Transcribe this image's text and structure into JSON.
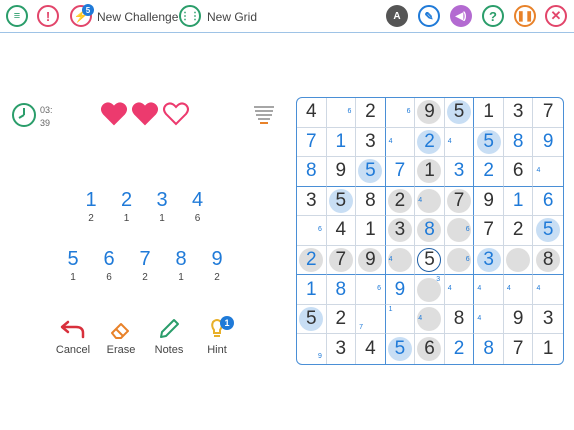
{
  "toolbar": {
    "new_challenge_label": "New Challenge",
    "new_grid_label": "New Grid",
    "challenge_badge": "5",
    "accent": "#1f7ad8",
    "icons": [
      "menu-icon",
      "alert-icon",
      "challenge-icon",
      "grid-icon",
      "contrast-icon",
      "palette-icon",
      "sound-icon",
      "help-icon",
      "pause-icon",
      "close-icon"
    ]
  },
  "timer": {
    "minutes": "03:",
    "seconds": "39"
  },
  "lives": {
    "total": 3,
    "remaining": 2
  },
  "numpad": [
    {
      "digit": "1",
      "count": "2"
    },
    {
      "digit": "2",
      "count": "1"
    },
    {
      "digit": "3",
      "count": "1"
    },
    {
      "digit": "4",
      "count": "6"
    },
    {
      "digit": "5",
      "count": "1"
    },
    {
      "digit": "6",
      "count": "6"
    },
    {
      "digit": "7",
      "count": "2"
    },
    {
      "digit": "8",
      "count": "1"
    },
    {
      "digit": "9",
      "count": "2"
    }
  ],
  "actions": {
    "cancel": "Cancel",
    "erase": "Erase",
    "notes": "Notes",
    "hint": "Hint",
    "hint_badge": "1"
  },
  "board": [
    [
      {
        "v": "4",
        "t": "g"
      },
      {
        "n": "6"
      },
      {
        "v": "2",
        "t": "g"
      },
      {
        "n": "6"
      },
      {
        "v": "9",
        "t": "g",
        "h": "gray"
      },
      {
        "v": "5",
        "t": "g",
        "h": "blue"
      },
      {
        "v": "1",
        "t": "g"
      },
      {
        "v": "3",
        "t": "g"
      },
      {
        "v": "7",
        "t": "g"
      }
    ],
    [
      {
        "v": "7",
        "t": "u"
      },
      {
        "v": "1",
        "t": "u"
      },
      {
        "v": "3",
        "t": "g"
      },
      {
        "n": "4"
      },
      {
        "v": "2",
        "t": "u",
        "h": "blue"
      },
      {
        "n": "4"
      },
      {
        "v": "5",
        "t": "u",
        "h": "blue"
      },
      {
        "v": "8",
        "t": "u"
      },
      {
        "v": "9",
        "t": "u"
      }
    ],
    [
      {
        "v": "8",
        "t": "u"
      },
      {
        "v": "9",
        "t": "g"
      },
      {
        "v": "5",
        "t": "u",
        "h": "blue"
      },
      {
        "v": "7",
        "t": "u"
      },
      {
        "v": "1",
        "t": "g",
        "h": "gray"
      },
      {
        "v": "3",
        "t": "u"
      },
      {
        "v": "2",
        "t": "u"
      },
      {
        "v": "6",
        "t": "g"
      },
      {
        "n": "4"
      }
    ],
    [
      {
        "v": "3",
        "t": "g"
      },
      {
        "v": "5",
        "t": "g",
        "h": "blue"
      },
      {
        "v": "8",
        "t": "g"
      },
      {
        "v": "2",
        "t": "g",
        "h": "gray"
      },
      {
        "n": "4",
        "h": "gray"
      },
      {
        "v": "7",
        "t": "g",
        "h": "gray"
      },
      {
        "v": "9",
        "t": "g"
      },
      {
        "v": "1",
        "t": "u"
      },
      {
        "v": "6",
        "t": "u"
      }
    ],
    [
      {
        "n": "6"
      },
      {
        "v": "4",
        "t": "g"
      },
      {
        "v": "1",
        "t": "g"
      },
      {
        "v": "3",
        "t": "g",
        "h": "gray"
      },
      {
        "v": "8",
        "t": "u",
        "h": "gray"
      },
      {
        "n": "6",
        "h": "gray"
      },
      {
        "v": "7",
        "t": "g"
      },
      {
        "v": "2",
        "t": "g"
      },
      {
        "v": "5",
        "t": "u",
        "h": "blue"
      }
    ],
    [
      {
        "v": "2",
        "t": "u",
        "h": "gray"
      },
      {
        "v": "7",
        "t": "g",
        "h": "gray"
      },
      {
        "v": "9",
        "t": "g",
        "h": "gray"
      },
      {
        "n": "4",
        "h": "gray"
      },
      {
        "v": "5",
        "t": "g",
        "h": "sel"
      },
      {
        "n": "6",
        "h": "gray"
      },
      {
        "v": "3",
        "t": "u",
        "h": "blue"
      },
      {
        "h": "gray"
      },
      {
        "v": "8",
        "t": "g",
        "h": "gray"
      }
    ],
    [
      {
        "v": "1",
        "t": "u"
      },
      {
        "v": "8",
        "t": "u"
      },
      {
        "n": "6"
      },
      {
        "v": "9",
        "t": "u"
      },
      {
        "n": "3",
        "h": "gray"
      },
      {
        "n": "4"
      },
      {
        "n": "4"
      },
      {
        "n": "4"
      },
      {
        "n": "4"
      }
    ],
    [
      {
        "v": "5",
        "t": "g",
        "h": "blue"
      },
      {
        "v": "2",
        "t": "g"
      },
      {
        "n": "7"
      },
      {
        "n": "1"
      },
      {
        "n": "4",
        "h": "gray"
      },
      {
        "v": "8",
        "t": "g"
      },
      {
        "n": "4"
      },
      {
        "v": "9",
        "t": "g"
      },
      {
        "v": "3",
        "t": "g"
      }
    ],
    [
      {
        "n": "9"
      },
      {
        "v": "3",
        "t": "g"
      },
      {
        "v": "4",
        "t": "g"
      },
      {
        "v": "5",
        "t": "u",
        "h": "blue"
      },
      {
        "v": "6",
        "t": "g",
        "h": "gray"
      },
      {
        "v": "2",
        "t": "u"
      },
      {
        "v": "8",
        "t": "u"
      },
      {
        "v": "7",
        "t": "g"
      },
      {
        "v": "1",
        "t": "g"
      }
    ]
  ]
}
